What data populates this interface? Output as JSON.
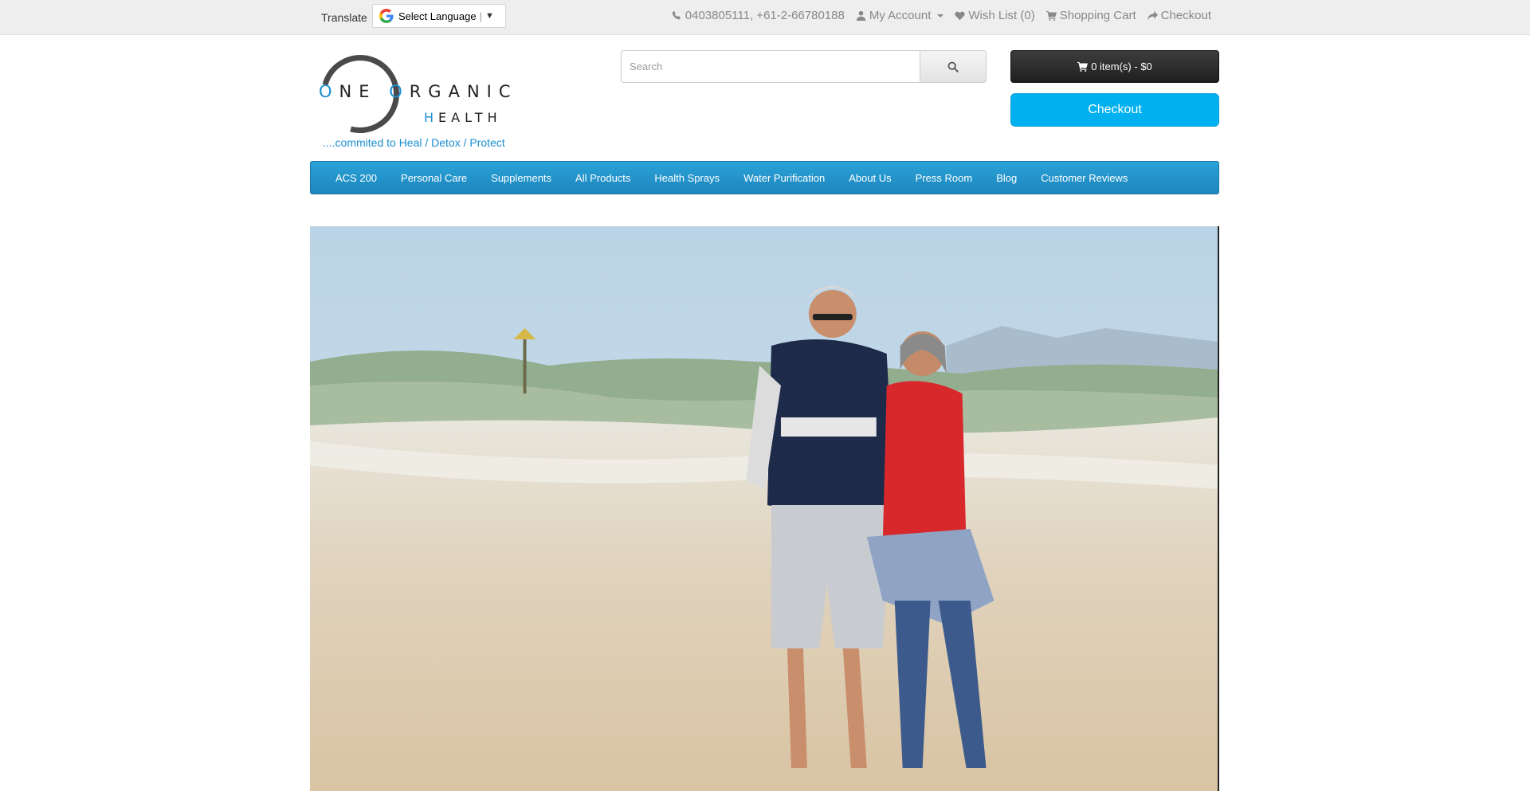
{
  "topbar": {
    "translate_label": "Translate",
    "language_select": "Select Language",
    "phone": "0403805111, +61-2-66780188",
    "my_account": "My Account",
    "wish_list": "Wish List (0)",
    "shopping_cart": "Shopping Cart",
    "checkout": "Checkout"
  },
  "logo": {
    "line1_o": "O",
    "line1_rest": "NE ",
    "line1_o2": "O",
    "line1_rest2": "RGANIC",
    "line2_h": "H",
    "line2_rest": "EALTH",
    "tagline": "....commited to Heal / Detox / Protect"
  },
  "search": {
    "placeholder": "Search"
  },
  "cart": {
    "label": "0 item(s) - $0"
  },
  "checkout_button": "Checkout",
  "nav": {
    "items": [
      {
        "label": "ACS 200"
      },
      {
        "label": "Personal Care"
      },
      {
        "label": "Supplements"
      },
      {
        "label": "All Products"
      },
      {
        "label": "Health Sprays"
      },
      {
        "label": "Water Purification"
      },
      {
        "label": "About Us"
      },
      {
        "label": "Press Room"
      },
      {
        "label": "Blog"
      },
      {
        "label": "Customer Reviews"
      }
    ]
  },
  "colors": {
    "brand_blue": "#1a8fd1",
    "nav_blue": "#1d85be",
    "checkout_blue": "#00b0ef"
  },
  "icons": [
    "phone-icon",
    "user-icon",
    "heart-icon",
    "cart-icon",
    "share-icon",
    "search-icon",
    "google-icon"
  ]
}
